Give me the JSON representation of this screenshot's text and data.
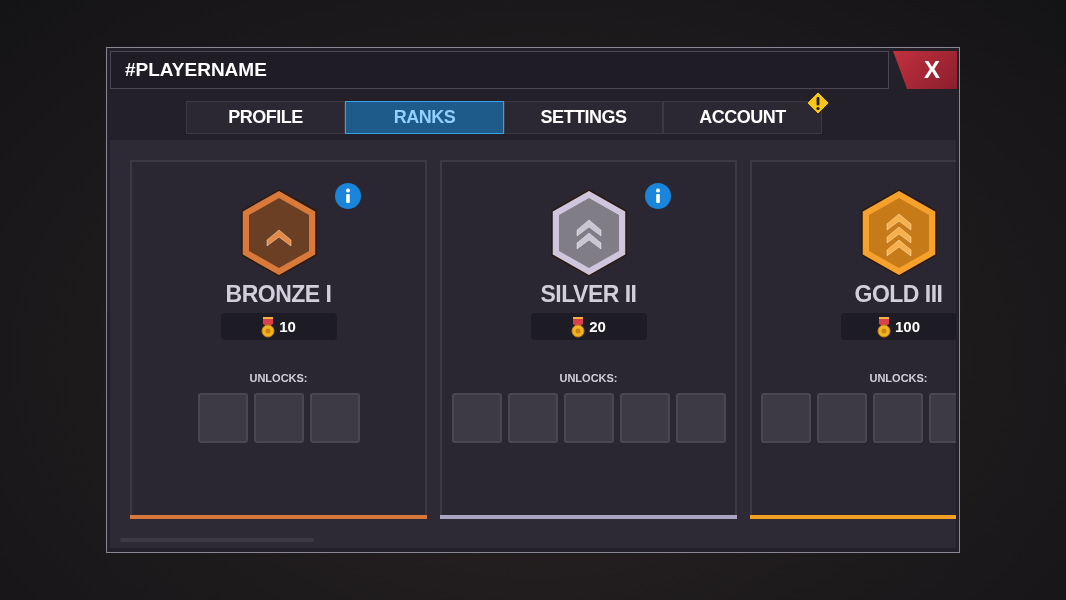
{
  "window": {
    "title": "#PLAYERNAME",
    "close_label": "X"
  },
  "tabs": [
    {
      "label": "PROFILE",
      "selected": false,
      "alert": false
    },
    {
      "label": "RANKS",
      "selected": true,
      "alert": false
    },
    {
      "label": "SETTINGS",
      "selected": false,
      "alert": false
    },
    {
      "label": "ACCOUNT",
      "selected": false,
      "alert": true
    }
  ],
  "ranks": [
    {
      "kind": "bronze",
      "name": "BRONZE I",
      "points": "10",
      "info": true,
      "unlocks_label": "UNLOCKS:",
      "unlocks": [
        {
          "kind": "empty"
        },
        {
          "kind": "empty"
        },
        {
          "kind": "empty"
        }
      ]
    },
    {
      "kind": "silver",
      "name": "SILVER II",
      "points": "20",
      "info": true,
      "unlocks_label": "UNLOCKS:",
      "unlocks": [
        {
          "kind": "empty"
        },
        {
          "kind": "empty"
        },
        {
          "kind": "empty"
        },
        {
          "kind": "empty"
        },
        {
          "kind": "empty"
        }
      ]
    },
    {
      "kind": "gold",
      "name": "GOLD III",
      "points": "100",
      "info": false,
      "unlocks_label": "UNLOCKS:",
      "unlocks": [
        {
          "kind": "empty"
        },
        {
          "kind": "empty"
        },
        {
          "kind": "empty"
        },
        {
          "kind": "empty"
        }
      ]
    }
  ]
}
